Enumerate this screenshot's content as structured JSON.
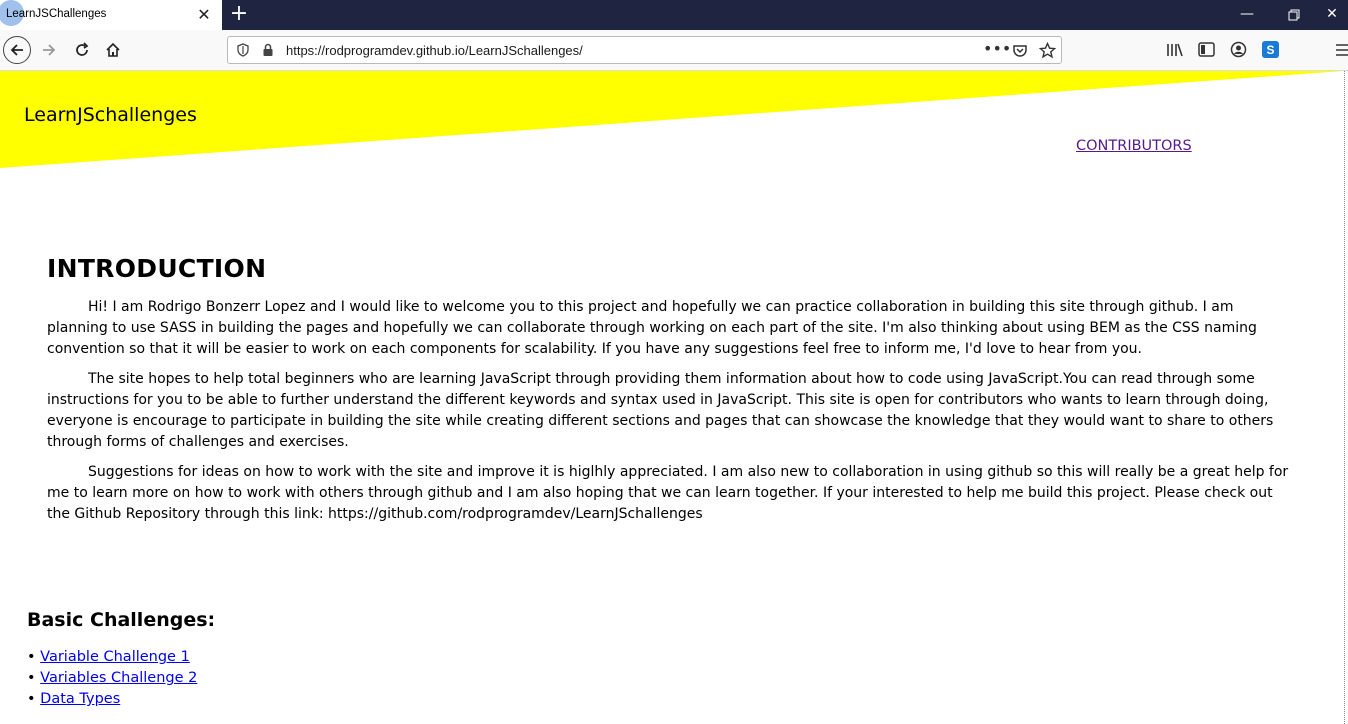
{
  "browser": {
    "tab_title": "LearnJSChallenges",
    "url": "https://rodprogramdev.github.io/LearnJSchallenges/",
    "colors": {
      "tabstrip": "#1f2440",
      "toolbar": "#f9f9fa"
    }
  },
  "site": {
    "title": "LearnJSchallenges",
    "nav": {
      "contributors": "CONTRIBUTORS"
    },
    "banner_color": "#ffff00"
  },
  "intro": {
    "heading": "INTRODUCTION",
    "paragraphs": [
      "Hi! I am Rodrigo Bonzerr Lopez and I would like to welcome you to this project and hopefully we can practice collaboration in building this site through github. I am planning to use SASS in building the pages and hopefully we can collaborate through working on each part of the site. I'm also thinking about using BEM as the CSS naming convention so that it will be easier to work on each components for scalability. If you have any suggestions feel free to inform me, I'd love to hear from you.",
      "The site hopes to help total beginners who are learning JavaScript through providing them information about how to code using JavaScript.You can read through some instructions for you to be able to further understand the different keywords and syntax used in JavaScript. This site is open for contributors who wants to learn through doing, everyone is encourage to participate in building the site while creating different sections and pages that can showcase the knowledge that they would want to share to others through forms of challenges and exercises.",
      "Suggestions for ideas on how to work with the site and improve it is higlhly appreciated. I am also new to collaboration in using github so this will really be a great help for me to learn more on how to work with others through github and I am also hoping that we can learn together. If your interested to help me build this project. Please check out the Github Repository through this link: https://github.com/rodprogramdev/LearnJSchallenges"
    ]
  },
  "challenges": {
    "heading": "Basic Challenges:",
    "items": [
      {
        "label": "Variable Challenge 1"
      },
      {
        "label": "Variables Challenge 2"
      },
      {
        "label": "Data Types"
      }
    ]
  }
}
